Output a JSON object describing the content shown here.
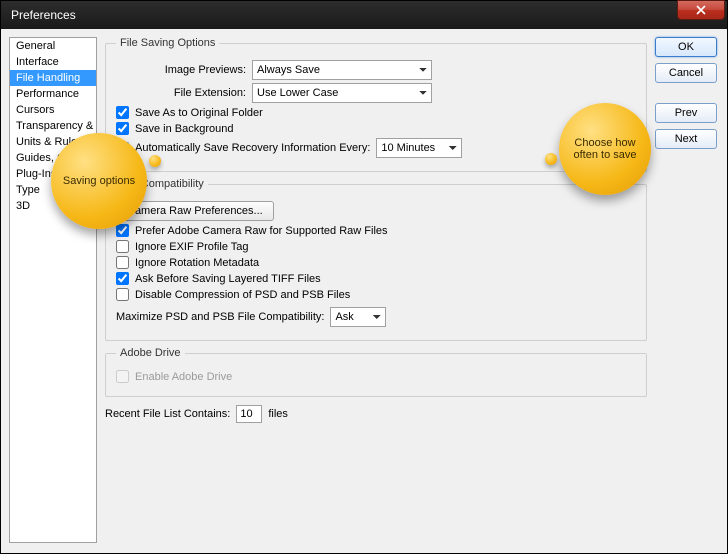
{
  "window": {
    "title": "Preferences"
  },
  "sidebar": {
    "items": [
      "General",
      "Interface",
      "File Handling",
      "Performance",
      "Cursors",
      "Transparency & Gamut",
      "Units & Rulers",
      "Guides, Grid & Slices",
      "Plug-Ins",
      "Type",
      "3D"
    ],
    "selectedIndex": 2
  },
  "buttons": {
    "ok": "OK",
    "cancel": "Cancel",
    "prev": "Prev",
    "next": "Next"
  },
  "callouts": {
    "left": "Saving options",
    "right": "Choose how often to save"
  },
  "fileSaving": {
    "legend": "File Saving Options",
    "imagePreviewsLabel": "Image Previews:",
    "imagePreviewsValue": "Always Save",
    "fileExtensionLabel": "File Extension:",
    "fileExtensionValue": "Use Lower Case",
    "saveAsOriginal": {
      "label": "Save As to Original Folder",
      "checked": true
    },
    "saveInBackground": {
      "label": "Save in Background",
      "checked": true
    },
    "autoSave": {
      "label": "Automatically Save Recovery Information Every:",
      "checked": true,
      "value": "10 Minutes"
    }
  },
  "fileCompat": {
    "legend": "File Compatibility",
    "cameraRawBtn": "Camera Raw Preferences...",
    "preferRaw": {
      "label": "Prefer Adobe Camera Raw for Supported Raw Files",
      "checked": true
    },
    "ignoreExif": {
      "label": "Ignore EXIF Profile Tag",
      "checked": false
    },
    "ignoreRotation": {
      "label": "Ignore Rotation Metadata",
      "checked": false
    },
    "askTiff": {
      "label": "Ask Before Saving Layered TIFF Files",
      "checked": true
    },
    "disableCompression": {
      "label": "Disable Compression of PSD and PSB Files",
      "checked": false
    },
    "maximizeLabel": "Maximize PSD and PSB File Compatibility:",
    "maximizeValue": "Ask"
  },
  "adobeDrive": {
    "legend": "Adobe Drive",
    "enable": {
      "label": "Enable Adobe Drive",
      "checked": false
    }
  },
  "recent": {
    "label": "Recent File List Contains:",
    "value": "10",
    "suffix": "files"
  }
}
